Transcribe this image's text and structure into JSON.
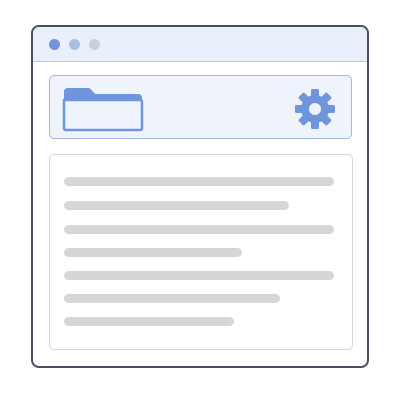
{
  "window": {
    "controls": [
      "close-dot",
      "minimize-dot",
      "maximize-dot"
    ],
    "colors": {
      "frame": "#4a5061",
      "titlebar": "#eaf0fb",
      "accent": "#6f95dc",
      "placeholder_text": "#d6d6d6"
    }
  },
  "toolbar": {
    "icons": [
      "folder-icon",
      "gear-icon"
    ]
  },
  "content": {
    "placeholder_line_count": 7
  }
}
